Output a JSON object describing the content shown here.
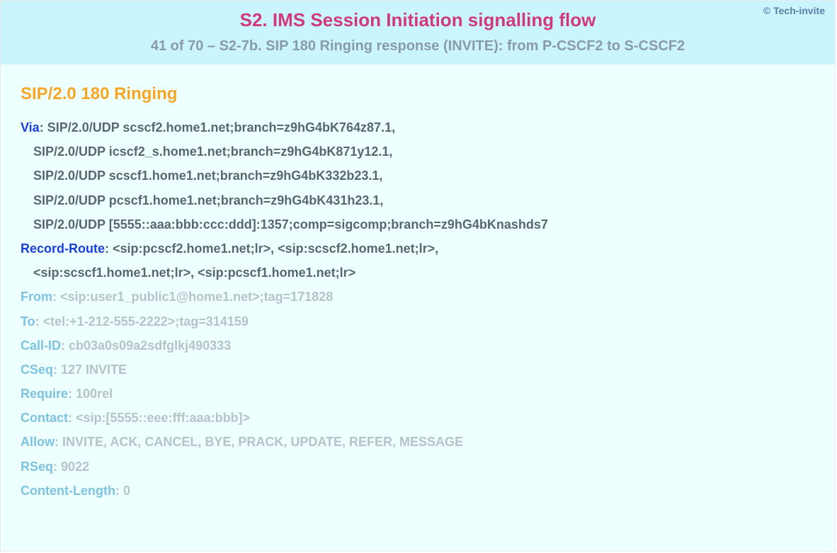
{
  "copyright": "© Tech-invite",
  "header": {
    "title": "S2. IMS Session Initiation signalling flow",
    "subtitle": "41 of 70 – S2-7b. SIP 180 Ringing response (INVITE): from P-CSCF2 to S-CSCF2"
  },
  "status_line": "SIP/2.0 180 Ringing",
  "via": {
    "name": "Via",
    "values": [
      "SIP/2.0/UDP scscf2.home1.net;branch=z9hG4bK764z87.1,",
      "SIP/2.0/UDP icscf2_s.home1.net;branch=z9hG4bK871y12.1,",
      "SIP/2.0/UDP scscf1.home1.net;branch=z9hG4bK332b23.1,",
      "SIP/2.0/UDP pcscf1.home1.net;branch=z9hG4bK431h23.1,",
      "SIP/2.0/UDP [5555::aaa:bbb:ccc:ddd]:1357;comp=sigcomp;branch=z9hG4bKnashds7"
    ]
  },
  "record_route": {
    "name": "Record-Route",
    "line1": "<sip:pcscf2.home1.net;lr>, <sip:scscf2.home1.net;lr>,",
    "line2": "<sip:scscf1.home1.net;lr>, <sip:pcscf1.home1.net;lr>"
  },
  "headers": {
    "from": {
      "name": "From",
      "value": "<sip:user1_public1@home1.net>;tag=171828"
    },
    "to": {
      "name": "To",
      "value": "<tel:+1-212-555-2222>;tag=314159"
    },
    "call_id": {
      "name": "Call-ID",
      "value": "cb03a0s09a2sdfglkj490333"
    },
    "cseq": {
      "name": "CSeq",
      "value": "127 INVITE"
    },
    "require": {
      "name": "Require",
      "value": "100rel"
    },
    "contact": {
      "name": "Contact",
      "value": "<sip:[5555::eee:fff:aaa:bbb]>"
    },
    "allow": {
      "name": "Allow",
      "value": "INVITE, ACK, CANCEL, BYE, PRACK, UPDATE, REFER, MESSAGE"
    },
    "rseq": {
      "name": "RSeq",
      "value": "9022"
    },
    "content_length": {
      "name": "Content-Length",
      "value": "0"
    }
  }
}
